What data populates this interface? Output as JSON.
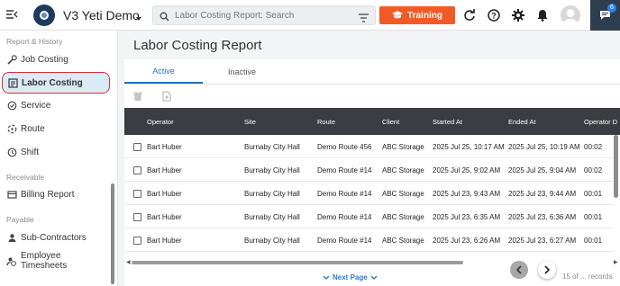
{
  "app": {
    "title": "V3 Yeti Demo",
    "search_placeholder": "Labor Costing Report: Search",
    "training_label": "Training",
    "chat_badge": "6",
    "accent": "#f15a24",
    "header_dark": "#2d3e50"
  },
  "sidebar": {
    "section_report": "Report & History",
    "job_costing": "Job Costing",
    "labor_costing": "Labor Costing",
    "service": "Service",
    "route": "Route",
    "shift": "Shift",
    "section_receivable": "Receivable",
    "billing_report": "Billing Report",
    "section_payable": "Payable",
    "sub_contractors": "Sub-Contractors",
    "employee_timesheets": "Employee Timesheets"
  },
  "page": {
    "title": "Labor Costing Report",
    "tab_active": "Active",
    "tab_inactive": "Inactive"
  },
  "table": {
    "columns": [
      "Operator",
      "Site",
      "Route",
      "Client",
      "Started At",
      "Ended At",
      "Operator D"
    ],
    "rows": [
      [
        "Bart Huber",
        "Burnaby City Hall",
        "Demo Route 456",
        "ABC Storage",
        "2025 Jul 25, 10:17 AM",
        "2025 Jul 25, 10:19 AM",
        "00:02"
      ],
      [
        "Bart Huber",
        "Burnaby City Hall",
        "Demo Route #14",
        "ABC Storage",
        "2025 Jul 25, 9:02 AM",
        "2025 Jul 25, 9:04 AM",
        "00:02"
      ],
      [
        "Bart Huber",
        "Burnaby City Hall",
        "Demo Route #14",
        "ABC Storage",
        "2025 Jul 23, 9:43 AM",
        "2025 Jul 23, 9:44 AM",
        "00:01"
      ],
      [
        "Bart Huber",
        "Burnaby City Hall",
        "Demo Route #14",
        "ABC Storage",
        "2025 Jul 23, 6:35 AM",
        "2025 Jul 23, 6:36 AM",
        "00:01"
      ],
      [
        "Bart Huber",
        "Burnaby City Hall",
        "Demo Route #14",
        "ABC Storage",
        "2025 Jul 23, 6:26 AM",
        "2025 Jul 23, 6:27 AM",
        "00:01"
      ]
    ]
  },
  "pagination": {
    "next_page": "Next Page",
    "records": "15 of ... records"
  }
}
